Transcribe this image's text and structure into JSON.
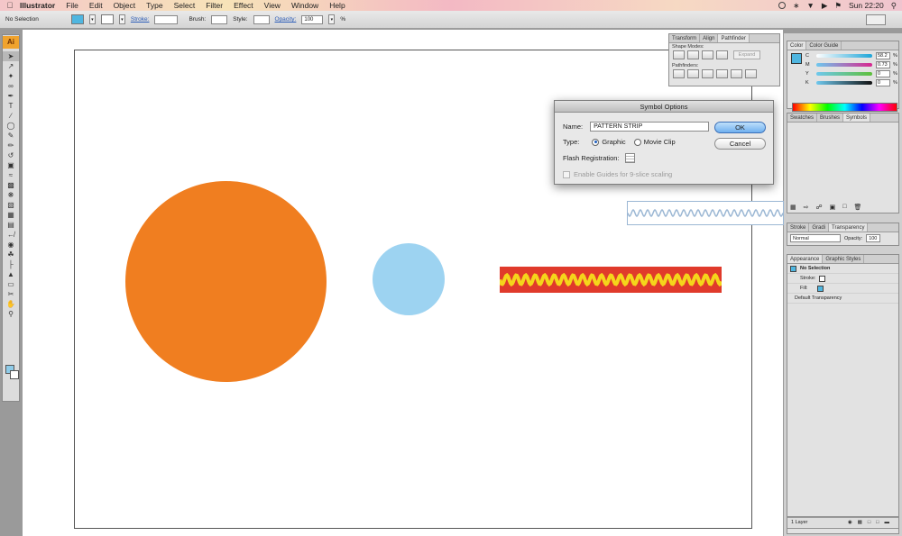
{
  "menubar": {
    "app_name": "Illustrator",
    "items": [
      "File",
      "Edit",
      "Object",
      "Type",
      "Select",
      "Filter",
      "Effect",
      "View",
      "Window",
      "Help"
    ],
    "clock": "Sun 22:20"
  },
  "controlbar": {
    "selection": "No Selection",
    "stroke_label": "Stroke:",
    "brush_label": "Brush:",
    "style_label": "Style:",
    "opacity_label": "Opacity:",
    "opacity_value": "100",
    "opacity_unit": "%"
  },
  "toolbox": {
    "logo": "Ai"
  },
  "pathfinder_panel": {
    "tabs": [
      "Transform",
      "Align",
      "Pathfinder"
    ],
    "shape_modes_label": "Shape Modes:",
    "expand_label": "Expand",
    "pathfinders_label": "Pathfinders:"
  },
  "dialog": {
    "title": "Symbol Options",
    "name_label": "Name:",
    "name_value": "PATTERN STRIP",
    "type_label": "Type:",
    "type_options": [
      "Graphic",
      "Movie Clip"
    ],
    "type_selected": "Graphic",
    "flash_registration_label": "Flash Registration:",
    "guides_label": "Enable Guides for 9-slice scaling",
    "ok_label": "OK",
    "cancel_label": "Cancel"
  },
  "color_panel": {
    "tabs": [
      "Color",
      "Color Guide"
    ],
    "channels": [
      {
        "label": "C",
        "value": "58.2",
        "color": "#1ea5d8"
      },
      {
        "label": "M",
        "value": "0.73",
        "color": "#d8278f"
      },
      {
        "label": "Y",
        "value": "0",
        "color": "#e8d81e"
      },
      {
        "label": "K",
        "value": "0",
        "color": "#222222"
      }
    ],
    "unit": "%"
  },
  "symbols_panel": {
    "tabs": [
      "Swatches",
      "Brushes",
      "Symbols"
    ]
  },
  "transparency_panel": {
    "tabs": [
      "Stroke",
      "Gradi",
      "Transparency"
    ],
    "blend_mode": "Normal",
    "opacity_label": "Opacity:",
    "opacity_value": "100"
  },
  "appearance_panel": {
    "tabs": [
      "Appearance",
      "Graphic Styles"
    ],
    "header": "No Selection",
    "stroke_label": "Stroke:",
    "fill_label": "Fill:",
    "default_transparency": "Default Transparency"
  },
  "layers_footer": {
    "count": "1 Layer"
  },
  "colors": {
    "orange_circle": "#f07e20",
    "blue_circle": "#9dd3f1",
    "strip_red": "#e03a2b",
    "strip_wave": "#f5d51b",
    "fill_swatch": "#4fb6e0"
  }
}
